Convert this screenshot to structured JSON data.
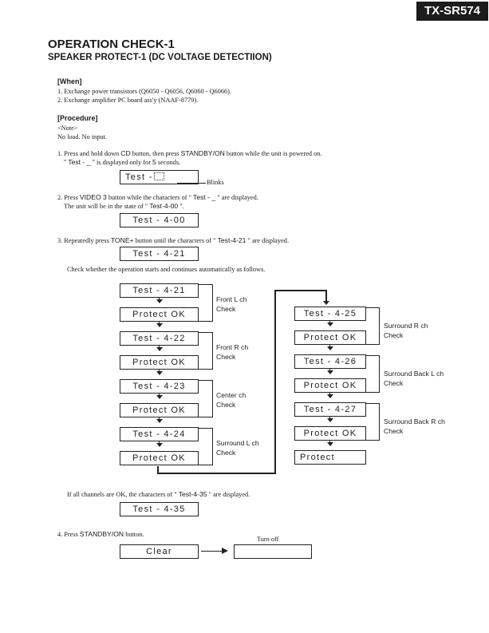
{
  "header": {
    "model": "TX-SR574",
    "title": "OPERATION CHECK-1",
    "subtitle": "SPEAKER PROTECT-1 (DC VOLTAGE DETECTIION)"
  },
  "when": {
    "heading": "[When]",
    "items": [
      "1. Exchange power transistors (Q6050 - Q6056, Q6060 - Q6066).",
      "2. Exchange amplifier PC board ass'y (NAAF-8779)."
    ]
  },
  "procedure": {
    "heading": "[Procedure]",
    "note_label": "<Note>",
    "note_text": "No load.  No input."
  },
  "step1": {
    "line1_a": "1. Press and hold down ",
    "line1_btn1": "CD",
    "line1_b": " button, then press ",
    "line1_btn2": "STANDBY/ON",
    "line1_c": " button while the unit is powered on.",
    "line2_a": "\" Test - _ \"",
    "line2_b": "  is displayed only for ",
    "line2_num": "5",
    "line2_c": " seconds.",
    "display": "Test -",
    "blink_label": "Blinks"
  },
  "step2": {
    "line1_a": "2. Press ",
    "line1_btn": "VIDEO 3",
    "line1_b": " button while the characters of \" ",
    "line1_code": "Test - _",
    "line1_c": " \"  are displayed.",
    "line2_a": "The unit will be in the state of \"  ",
    "line2_code": "Test-4-00",
    "line2_b": " \".",
    "display": "Test - 4-00"
  },
  "step3": {
    "line1_a": "3. Repeatedly press ",
    "line1_btn": "TONE+",
    "line1_b": " button until the characters of \" ",
    "line1_code": "Test-4-21",
    "line1_c": " \" are displayed.",
    "display": "Test - 4-21",
    "note": "Check whether the operation starts and continues automatically as follows."
  },
  "flow": {
    "left": [
      {
        "test": "Test - 4-21",
        "result": "Protect OK",
        "label1": "Front L ch",
        "label2": "Check"
      },
      {
        "test": "Test - 4-22",
        "result": "Protect OK",
        "label1": "Front R ch",
        "label2": "Check"
      },
      {
        "test": "Test - 4-23",
        "result": "Protect OK",
        "label1": "Center ch",
        "label2": "Check"
      },
      {
        "test": "Test - 4-24",
        "result": "Protect OK",
        "label1": "Surround L ch",
        "label2": "Check"
      }
    ],
    "right": [
      {
        "test": "Test - 4-25",
        "result": "Protect OK",
        "label1": "Surround R ch",
        "label2": "Check"
      },
      {
        "test": "Test - 4-26",
        "result": "Protect OK",
        "label1": "Surround Back L ch",
        "label2": "Check"
      },
      {
        "test": "Test - 4-27",
        "result": "Protect OK",
        "label1": "Surround Back R ch",
        "label2": "Check"
      }
    ],
    "final": "Protect"
  },
  "result": {
    "line_a": "If all channels are OK, the characters of \" ",
    "line_code": "Test-4-35",
    "line_b": " \" are displayed.",
    "display": "Test - 4-35"
  },
  "step4": {
    "line_a": "4. Press ",
    "line_btn": "STANDBY/ON",
    "line_b": " button.",
    "display": "Clear",
    "turn_off_label": "Turn off",
    "display_after": ""
  }
}
